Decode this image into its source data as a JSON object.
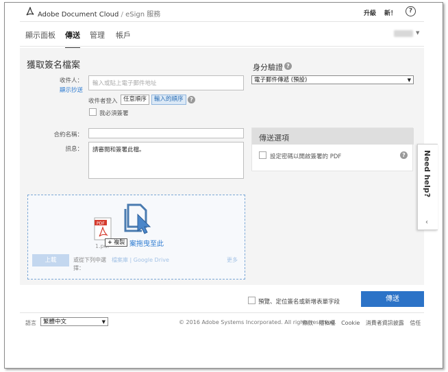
{
  "header": {
    "brand": "Adobe Document Cloud",
    "separator": "/",
    "service": "eSign 服務",
    "upgrade": "升級",
    "new": "新！",
    "help": "?"
  },
  "nav": {
    "tabs": [
      {
        "label": "顯示面板"
      },
      {
        "label": "傳送",
        "active": true
      },
      {
        "label": "管理"
      },
      {
        "label": "帳戶"
      }
    ]
  },
  "form": {
    "title": "獲取簽名檔案",
    "recipients_label": "收件人：",
    "show_cc": "顯示抄送",
    "recipients_placeholder": "輸入或貼上電子郵件地址",
    "signing_order_label": "收件者登入",
    "order_any": "任意順序",
    "order_entered": "輸入的順序",
    "i_must_sign": "我必須簽署",
    "agreement_name_label": "合約名稱：",
    "message_label": "訊息：",
    "message_value": "請審閱和簽署此檔。"
  },
  "identity": {
    "title": "身分驗證",
    "method": "電子郵件傳遞 (預設)"
  },
  "options": {
    "title": "傳送選項",
    "password_label": "設定密碼以開啟簽署的 PDF"
  },
  "dropzone": {
    "text": "案拖曳至此",
    "upload_button": "上載",
    "or_text": "或從下列中選擇：",
    "sources": "檔案庫 | Google Drive",
    "more": "更多",
    "file_name": "1.pdf",
    "copy_badge": "複製",
    "pdf_label": "PDF"
  },
  "bottom": {
    "preview_label": "預覽、定位簽名或新增表單字段",
    "send_button": "傳送"
  },
  "footer": {
    "language_label": "語言",
    "language_value": "繁體中文",
    "copyright": "© 2016 Adobe Systems Incorporated. All rights reserved.",
    "links": [
      "條款",
      "隱私權",
      "Cookie",
      "消費者資訊披露",
      "信任"
    ]
  },
  "need_help": {
    "label": "Need help?"
  },
  "colors": {
    "accent": "#2c73c7",
    "link": "#2d7bd1",
    "panel_bg": "#f4f4f4"
  }
}
